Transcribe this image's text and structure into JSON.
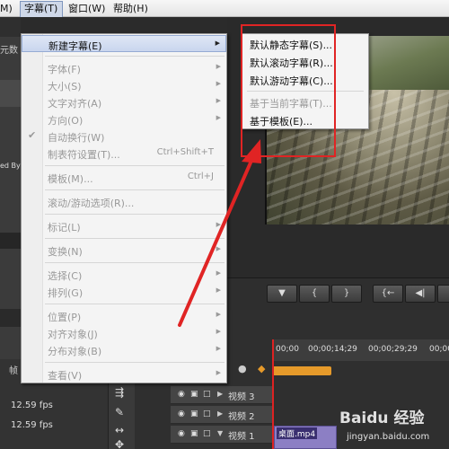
{
  "menubar": {
    "clip_partial": "M)",
    "subtitle": "字幕(T)",
    "window": "窗口(W)",
    "help": "帮助(H)"
  },
  "left_panel": {
    "text_partial_1": "元数",
    "text_partial_2": "ed By"
  },
  "subtitle_menu": {
    "items": [
      {
        "label": "新建字幕(E)",
        "shortcut": "",
        "submenu": true,
        "enabled": true,
        "highlighted": true
      },
      {
        "label": "字体(F)",
        "shortcut": "",
        "submenu": true,
        "enabled": false
      },
      {
        "label": "大小(S)",
        "shortcut": "",
        "submenu": true,
        "enabled": false
      },
      {
        "label": "文字对齐(A)",
        "shortcut": "",
        "submenu": true,
        "enabled": false
      },
      {
        "label": "方向(O)",
        "shortcut": "",
        "submenu": true,
        "enabled": false
      },
      {
        "label": "自动换行(W)",
        "shortcut": "",
        "submenu": false,
        "enabled": false,
        "checked": true
      },
      {
        "label": "制表符设置(T)...",
        "shortcut": "Ctrl+Shift+T",
        "submenu": false,
        "enabled": false
      },
      {
        "label": "模板(M)...",
        "shortcut": "Ctrl+J",
        "submenu": false,
        "enabled": false
      },
      {
        "label": "滚动/游动选项(R)...",
        "shortcut": "",
        "submenu": false,
        "enabled": false
      },
      {
        "label": "标记(L)",
        "shortcut": "",
        "submenu": true,
        "enabled": false
      },
      {
        "label": "变换(N)",
        "shortcut": "",
        "submenu": true,
        "enabled": false
      },
      {
        "label": "选择(C)",
        "shortcut": "",
        "submenu": true,
        "enabled": false
      },
      {
        "label": "排列(G)",
        "shortcut": "",
        "submenu": true,
        "enabled": false
      },
      {
        "label": "位置(P)",
        "shortcut": "",
        "submenu": true,
        "enabled": false
      },
      {
        "label": "对齐对象(J)",
        "shortcut": "",
        "submenu": true,
        "enabled": false
      },
      {
        "label": "分布对象(B)",
        "shortcut": "",
        "submenu": true,
        "enabled": false
      },
      {
        "label": "查看(V)",
        "shortcut": "",
        "submenu": true,
        "enabled": false
      }
    ]
  },
  "new_subtitle_submenu": {
    "items": [
      {
        "label": "默认静态字幕(S)...",
        "enabled": true
      },
      {
        "label": "默认滚动字幕(R)...",
        "enabled": true
      },
      {
        "label": "默认游动字幕(C)...",
        "enabled": true
      },
      {
        "label": "基于当前字幕(T)...",
        "enabled": false
      },
      {
        "label": "基于模板(E)...",
        "enabled": true
      }
    ]
  },
  "transport": {
    "buttons": [
      "▼",
      "{",
      "}",
      "{←",
      "◀|",
      "◀"
    ]
  },
  "timeline": {
    "timecodes": [
      "00;00",
      "00;00;14;29",
      "00;00;29;29",
      "00;00"
    ],
    "tracks": [
      {
        "name": "视频 3"
      },
      {
        "name": "视频 2"
      },
      {
        "name": "视频 1"
      }
    ],
    "clip_label": "桌面.mp4"
  },
  "bottom_left": {
    "tab": "帧",
    "fps_1": "12.59 fps",
    "fps_2": "12.59 fps"
  },
  "watermark": {
    "brand": "Baidu 经验",
    "url": "jingyan.baidu.com"
  },
  "colors": {
    "annotation_red": "#e02424",
    "menu_highlight": "#c9d6ee",
    "clip_purple": "#8c7fc4",
    "work_area_orange": "#e69a2a"
  }
}
